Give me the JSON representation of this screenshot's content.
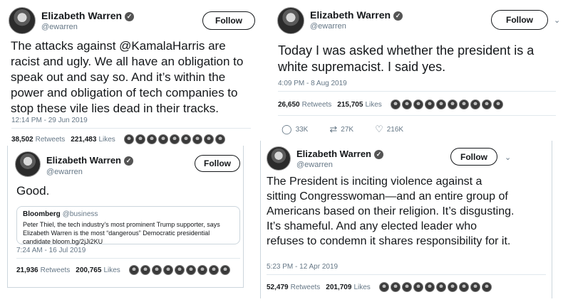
{
  "tweets": [
    {
      "name": "Elizabeth Warren",
      "handle": "@ewarren",
      "follow_label": "Follow",
      "text": "The attacks against @KamalaHarris are racist and ugly. We all have an obligation to speak out and say so. And it’s within the power and obligation of tech companies to stop these vile lies dead in their tracks.",
      "time": "12:14 PM - 29 Jun 2019",
      "retweets": "38,502",
      "retweets_label": "Retweets",
      "likes": "221,483",
      "likes_label": "Likes"
    },
    {
      "name": "Elizabeth Warren",
      "handle": "@ewarren",
      "follow_label": "Follow",
      "text": "Today I was asked whether the president is a white supremacist. I said yes.",
      "time": "4:09 PM - 8 Aug 2019",
      "retweets": "26,650",
      "retweets_label": "Retweets",
      "likes": "215,705",
      "likes_label": "Likes",
      "reply_count": "33K",
      "retweet_count": "27K",
      "like_count": "216K"
    },
    {
      "name": "Elizabeth Warren",
      "handle": "@ewarren",
      "follow_label": "Follow",
      "text": "Good.",
      "quote_source": "Bloomberg",
      "quote_handle": "@business",
      "quote_text": "Peter Thiel, the tech industry’s most prominent Trump supporter, says Elizabeth Warren is the most “dangerous” Democratic presidential candidate bloom.bg/2jJi2KU",
      "time": "7:24 AM - 16 Jul 2019",
      "retweets": "21,936",
      "retweets_label": "Retweets",
      "likes": "200,765",
      "likes_label": "Likes"
    },
    {
      "name": "Elizabeth Warren",
      "handle": "@ewarren",
      "follow_label": "Follow",
      "text": "The President is inciting violence against a sitting Congresswoman—and an entire group of Americans based on their religion. It’s disgusting. It’s shameful. And any elected leader who refuses to condemn it shares responsibility for it.",
      "time": "5:23 PM - 12 Apr 2019",
      "retweets": "52,479",
      "retweets_label": "Retweets",
      "likes": "201,709",
      "likes_label": "Likes"
    }
  ],
  "icons": {
    "verified": "verified-check-icon",
    "chevron": "chevron-down-icon",
    "reply": "reply-icon",
    "retweet": "retweet-icon",
    "like": "heart-icon"
  }
}
